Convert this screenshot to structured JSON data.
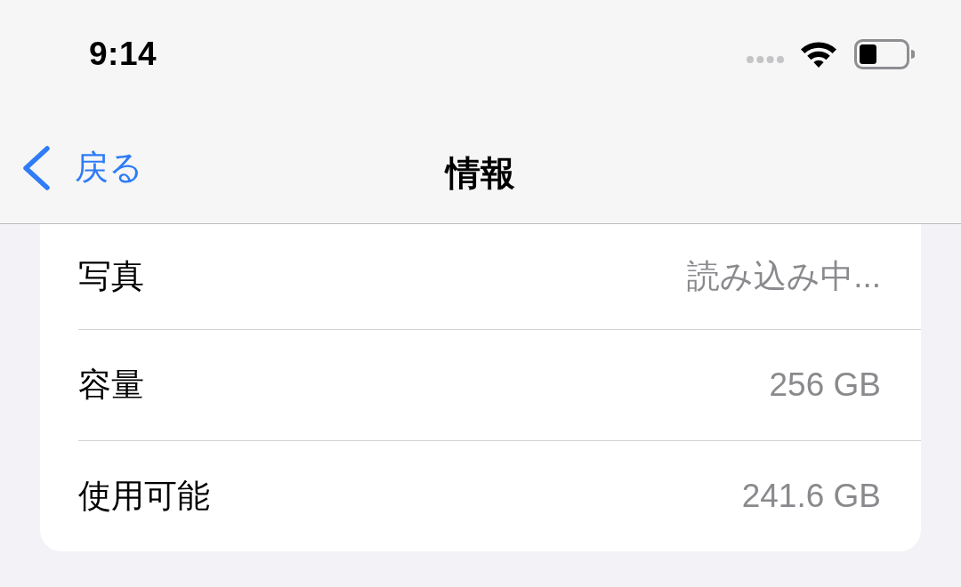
{
  "status_bar": {
    "time": "9:14"
  },
  "nav_bar": {
    "back_label": "戻る",
    "title": "情報"
  },
  "rows": [
    {
      "label": "写真",
      "value": "読み込み中..."
    },
    {
      "label": "容量",
      "value": "256 GB"
    },
    {
      "label": "使用可能",
      "value": "241.6 GB"
    }
  ]
}
